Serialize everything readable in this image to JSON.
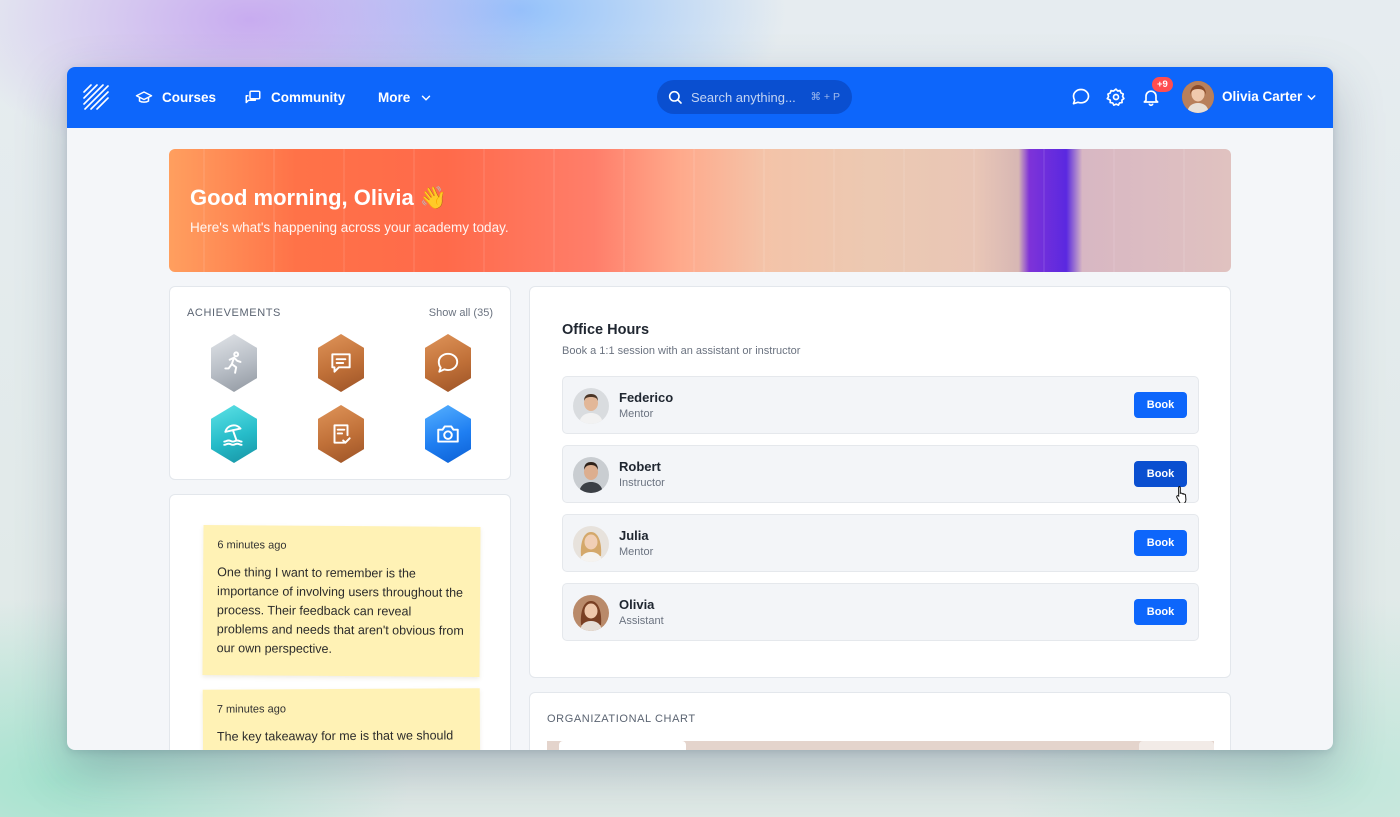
{
  "nav": {
    "courses": "Courses",
    "community": "Community",
    "more": "More"
  },
  "search": {
    "placeholder": "Search anything...",
    "shortcut": "⌘ + P"
  },
  "notifications": {
    "badge": "+9"
  },
  "user": {
    "name": "Olivia Carter"
  },
  "banner": {
    "greeting": "Good morning, Olivia 👋",
    "subtitle": "Here's what's happening across your academy today."
  },
  "achievements": {
    "title": "ACHIEVEMENTS",
    "show_all": "Show all (35)",
    "badges": [
      {
        "icon": "runner-icon",
        "color": "silver"
      },
      {
        "icon": "message-icon",
        "color": "bronze"
      },
      {
        "icon": "chat-bubble-icon",
        "color": "bronze"
      },
      {
        "icon": "beach-umbrella-icon",
        "color": "teal"
      },
      {
        "icon": "checklist-icon",
        "color": "bronze"
      },
      {
        "icon": "camera-icon",
        "color": "blue"
      }
    ]
  },
  "notes": [
    {
      "time": "6 minutes ago",
      "text": "One thing I want to remember is the importance of involving users throughout the process. Their feedback can reveal problems and needs that aren't obvious from our own perspective."
    },
    {
      "time": "7 minutes ago",
      "text": "The key takeaway for me is that we should"
    }
  ],
  "office_hours": {
    "title": "Office Hours",
    "subtitle": "Book a 1:1 session with an assistant or instructor",
    "book_label": "Book",
    "people": [
      {
        "name": "Federico",
        "role": "Mentor"
      },
      {
        "name": "Robert",
        "role": "Instructor"
      },
      {
        "name": "Julia",
        "role": "Mentor"
      },
      {
        "name": "Olivia",
        "role": "Assistant"
      }
    ]
  },
  "org_chart": {
    "title": "ORGANIZATIONAL CHART"
  },
  "colors": {
    "primary": "#0d66fb",
    "primary_dark": "#0a4fd0",
    "note_yellow": "#fff2b5",
    "badge_red": "#ff4d4f"
  }
}
